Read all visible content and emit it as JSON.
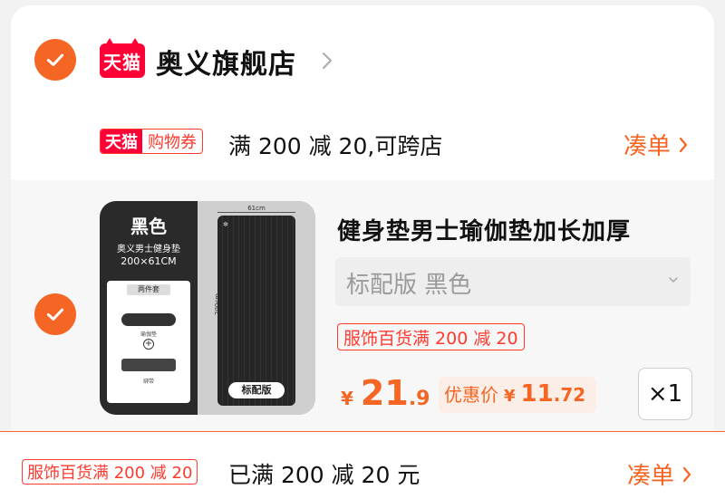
{
  "store": {
    "logo_text": "天猫",
    "name": "奥义旗舰店"
  },
  "coupon": {
    "brand": "天猫",
    "type": "购物券",
    "text": "满 200 减 20,可跨店",
    "link_label": "凑单"
  },
  "item": {
    "image": {
      "color_title": "黑色",
      "product_line": "奥义男士健身垫",
      "size": "200×61CM",
      "set_label": "两件套",
      "part1": "瑜伽垫",
      "part2": "绑带",
      "width_label": "61cm",
      "length_label": "200cm",
      "edition_label": "标配版"
    },
    "title": "健身垫男士瑜伽垫加长加厚",
    "sku": "标配版 黑色",
    "promo": "服饰百货满 200 减 20",
    "price": {
      "currency": "¥",
      "integer": "21",
      "decimal": ".9"
    },
    "discount": {
      "label": "优惠价",
      "currency": "¥",
      "integer": "11",
      "decimal": ".72"
    },
    "quantity": "×1"
  },
  "bottom": {
    "tag": "服饰百货满 200 减 20",
    "text": "已满 200 减 20 元",
    "link_label": "凑单"
  },
  "colors": {
    "accent": "#f56524",
    "tmall_red": "#ff0036",
    "promo_red": "#ff3b30"
  },
  "icons": {
    "check": "check-icon",
    "chevron": "chevron-right-icon",
    "dropdown": "chevron-down-icon"
  }
}
